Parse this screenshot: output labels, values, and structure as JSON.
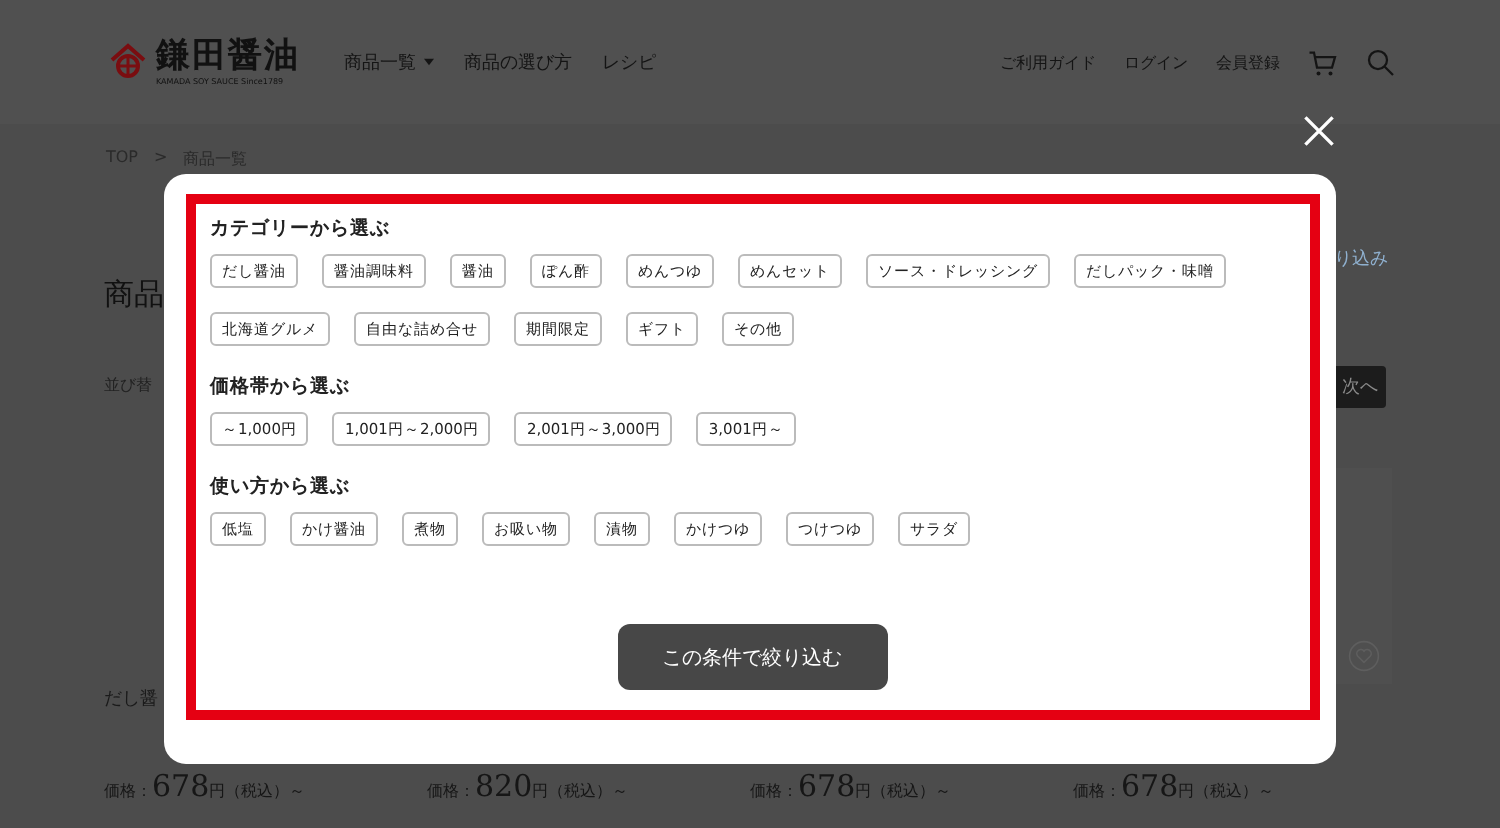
{
  "header": {
    "logo_title": "鎌田醤油",
    "logo_subtitle": "KAMADA SOY SAUCE Since1789",
    "nav": [
      {
        "label": "商品一覧",
        "dropdown": true
      },
      {
        "label": "商品の選び方",
        "dropdown": false
      },
      {
        "label": "レシピ",
        "dropdown": false
      }
    ],
    "utility_links": [
      "ご利用ガイド",
      "ログイン",
      "会員登録"
    ]
  },
  "breadcrumb": {
    "items": [
      "TOP",
      "商品一覧"
    ],
    "separator": ">"
  },
  "page": {
    "heading": "商品",
    "sort_label": "並び替",
    "filter_link": "り込み",
    "next_button": "次へ",
    "product_name": "だし醤",
    "prices": [
      {
        "label": "価格：",
        "amount": "678",
        "suffix": "円（税込）～"
      },
      {
        "label": "価格：",
        "amount": "820",
        "suffix": "円（税込）～"
      },
      {
        "label": "価格：",
        "amount": "678",
        "suffix": "円（税込）～"
      },
      {
        "label": "価格：",
        "amount": "678",
        "suffix": "円（税込）～"
      }
    ]
  },
  "modal": {
    "sections": [
      {
        "title": "カテゴリーから選ぶ",
        "chips": [
          "だし醤油",
          "醤油調味料",
          "醤油",
          "ぽん酢",
          "めんつゆ",
          "めんセット",
          "ソース・ドレッシング",
          "だしパック・味噌",
          "北海道グルメ",
          "自由な詰め合せ",
          "期間限定",
          "ギフト",
          "その他"
        ]
      },
      {
        "title": "価格帯から選ぶ",
        "chips": [
          "～1,000円",
          "1,001円～2,000円",
          "2,001円～3,000円",
          "3,001円～"
        ]
      },
      {
        "title": "使い方から選ぶ",
        "chips": [
          "低塩",
          "かけ醤油",
          "煮物",
          "お吸い物",
          "漬物",
          "かけつゆ",
          "つけつゆ",
          "サラダ"
        ]
      }
    ],
    "submit_button": "この条件で絞り込む"
  }
}
